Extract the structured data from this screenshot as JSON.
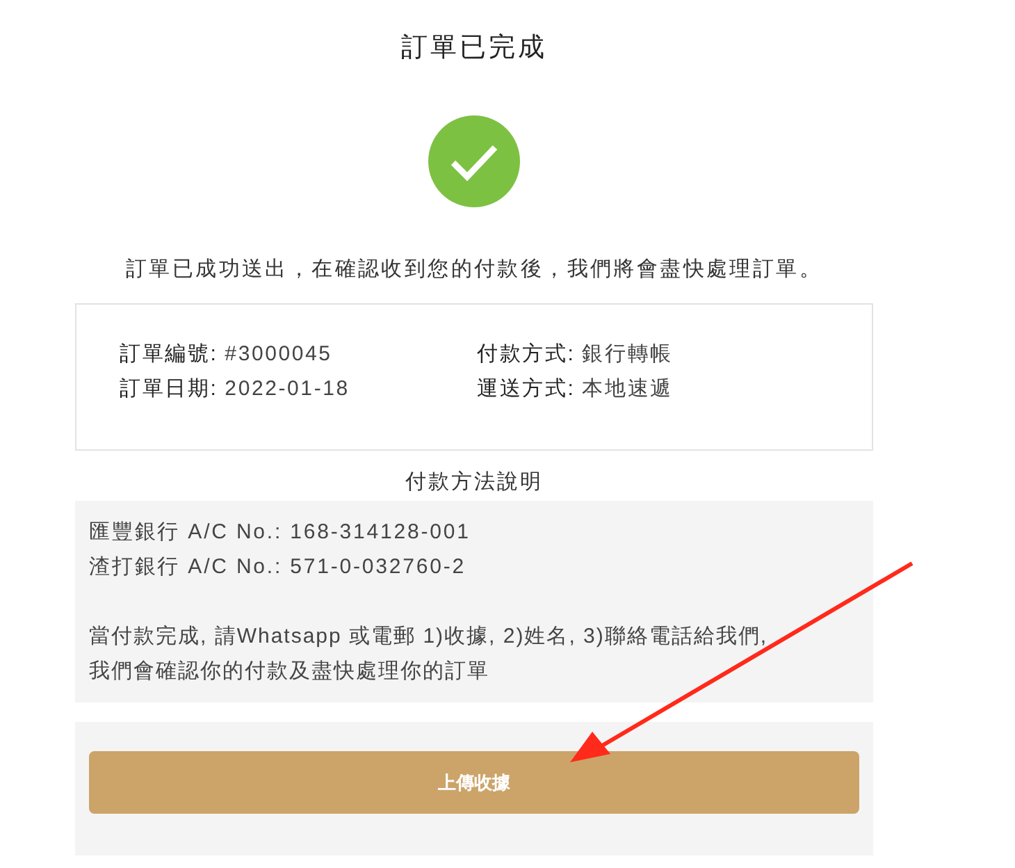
{
  "title": "訂單已完成",
  "message": "訂單已成功送出，在確認收到您的付款後，我們將會盡快處理訂單。",
  "order_info": [
    {
      "label": "訂單編號:",
      "value": "#3000045"
    },
    {
      "label": "付款方式:",
      "value": "銀行轉帳"
    },
    {
      "label": "訂單日期:",
      "value": "2022-01-18"
    },
    {
      "label": "運送方式:",
      "value": "本地速遞"
    }
  ],
  "payment_instructions": {
    "heading": "付款方法說明",
    "accounts": [
      "匯豐銀行 A/C No.: 168-314128-001",
      "渣打銀行 A/C No.: 571-0-032760-2"
    ],
    "note": "當付款完成, 請Whatsapp 或電郵 1)收據, 2)姓名, 3)聯絡電話給我們, 我們會確認你的付款及盡快處理你的訂單"
  },
  "upload_button": {
    "label": "上傳收據"
  }
}
